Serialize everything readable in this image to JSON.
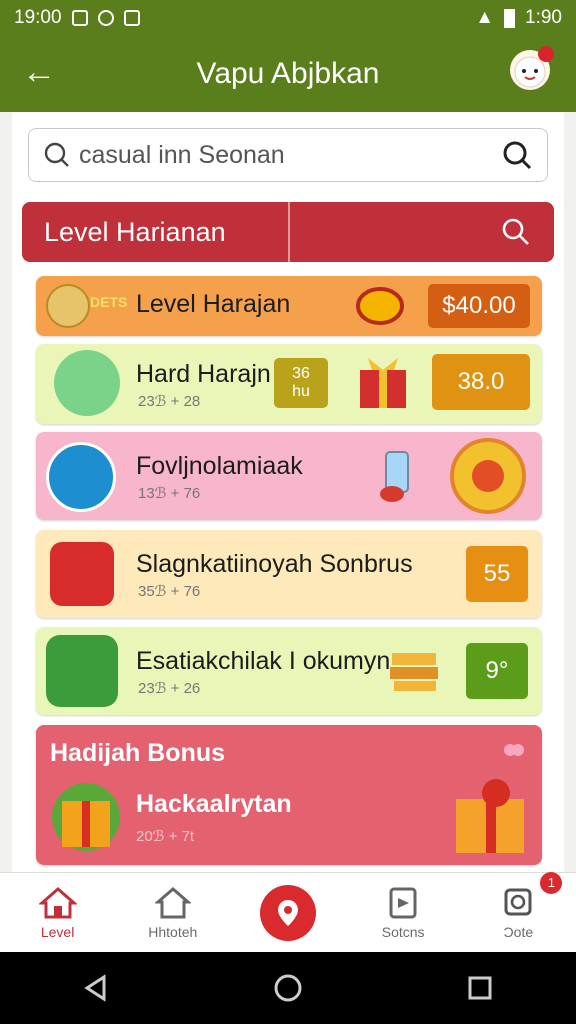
{
  "status": {
    "time_left": "19:00",
    "time_right": "1:90"
  },
  "app": {
    "title": "Vapu Abjbkan"
  },
  "search": {
    "value": "casual inn Seonan"
  },
  "header": {
    "label": "Level Harianan"
  },
  "cards": [
    {
      "prefix": "DETS",
      "title": "Level Harajan",
      "value": "$40.00"
    },
    {
      "title": "Hard Harajn",
      "meta": "23ℬ + 28",
      "badge_line1": "36",
      "badge_line2": "hu",
      "value": "38.0"
    },
    {
      "title": "Fovljnolamiaak",
      "meta": "13ℬ + 76"
    },
    {
      "title": "Slagnkatiinoyah Sonbrus",
      "meta": "35ℬ + 76",
      "value": "55"
    },
    {
      "title": "Esatiakchilak I okumyn",
      "meta": "23ℬ + 26",
      "value": "9°"
    }
  ],
  "bonus": {
    "title": "Hadijah Bonus",
    "subtitle": "Hackaalrytan",
    "meta": "20ℬ + 7t"
  },
  "nav": {
    "home": "Level",
    "hist": "Hhtoteh",
    "sorts": "Sotcns",
    "more": "Ɔote",
    "badge": "1"
  },
  "colors": {
    "green": "#5b7e1c",
    "red": "#c0303a",
    "orange": "#e08a1a"
  }
}
